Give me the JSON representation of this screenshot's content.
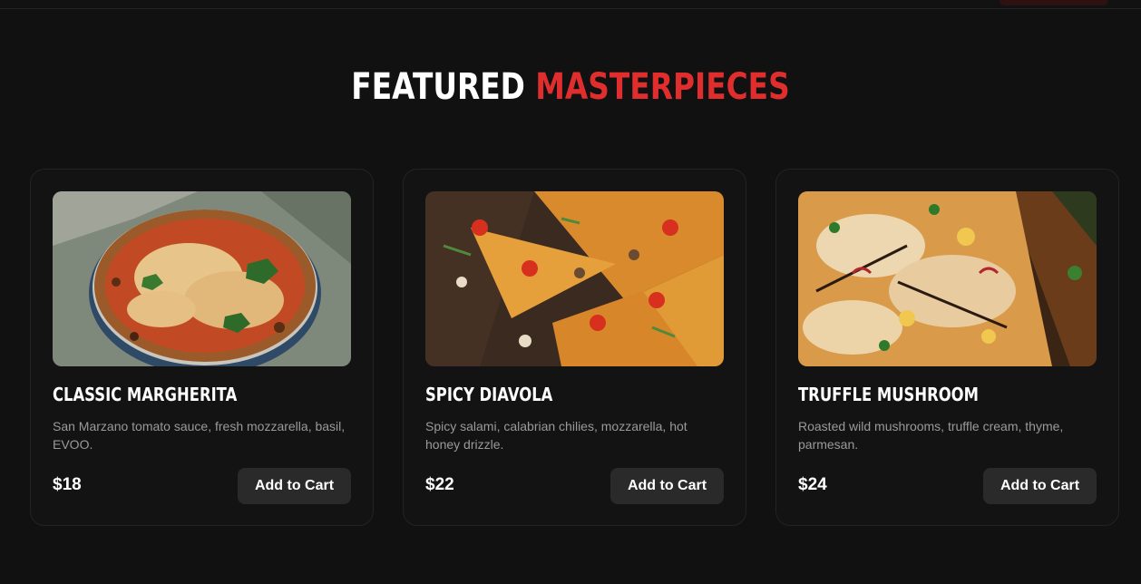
{
  "section": {
    "title_main": "FEATURED",
    "title_accent": "MASTERPIECES"
  },
  "products": [
    {
      "name": "CLASSIC MARGHERITA",
      "description": "San Marzano tomato sauce, fresh mozzarella, basil, EVOO.",
      "price": "$18",
      "button_label": "Add to Cart",
      "image": "margherita-pizza-photo"
    },
    {
      "name": "SPICY DIAVOLA",
      "description": "Spicy salami, calabrian chilies, mozzarella, hot honey drizzle.",
      "price": "$22",
      "button_label": "Add to Cart",
      "image": "diavola-pizza-photo"
    },
    {
      "name": "TRUFFLE MUSHROOM",
      "description": "Roasted wild mushrooms, truffle cream, thyme, parmesan.",
      "price": "$24",
      "button_label": "Add to Cart",
      "image": "truffle-mushroom-pizza-photo"
    }
  ],
  "colors": {
    "background": "#111111",
    "accent": "#e02d2d",
    "card_border": "#232323",
    "button_bg": "#2a2a2a",
    "muted_text": "#9a9a9a"
  }
}
